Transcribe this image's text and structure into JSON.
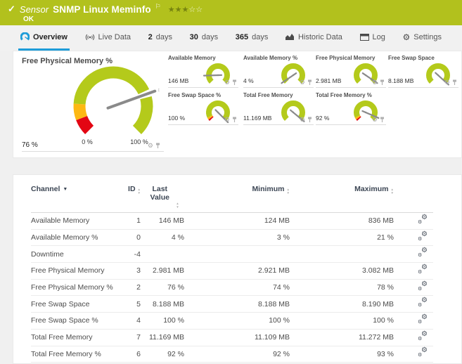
{
  "header": {
    "status_check": "✓",
    "type_label": "Sensor",
    "title": "SNMP Linux Meminfo",
    "flag": "⚐",
    "rating": {
      "filled": 3,
      "empty": 2
    },
    "status": "OK"
  },
  "tabs": {
    "overview": {
      "label": "Overview",
      "icon": "gauge-icon"
    },
    "live_data": {
      "label": "Live Data",
      "icon": "signal-icon"
    },
    "days2": {
      "num": "2",
      "word": "days"
    },
    "days30": {
      "num": "30",
      "word": "days"
    },
    "days365": {
      "num": "365",
      "word": "days"
    },
    "historic": {
      "label": "Historic Data",
      "icon": "chart-icon"
    },
    "log": {
      "label": "Log",
      "icon": "table-icon"
    },
    "settings": {
      "label": "Settings",
      "icon": "gear-icon"
    }
  },
  "colors": {
    "header_green": "#b2c11d",
    "gauge_green": "#b4ca1b",
    "warn_yellow": "#fdb813",
    "error_red": "#e30613",
    "accent_blue": "#1e9cd8",
    "needle_gray": "#8a8a8a"
  },
  "chart_data": {
    "type": "gauge",
    "main": {
      "title": "Free Physical Memory %",
      "value_label": "76 %",
      "percent": 76,
      "min_label": "0 %",
      "max_label": "100 %",
      "segments": [
        {
          "from": 0,
          "to": 9,
          "color": "#e30613"
        },
        {
          "from": 9,
          "to": 18,
          "color": "#fdb813"
        },
        {
          "from": 18,
          "to": 74,
          "color": "#b4ca1b"
        },
        {
          "from": 78,
          "to": 100,
          "color": "#b4ca1b"
        }
      ]
    },
    "small": [
      {
        "title": "Available Memory",
        "value_label": "146 MB",
        "percent": 16,
        "col": 0,
        "row": 0,
        "segments": [
          {
            "from": 0,
            "to": 100,
            "color": "#b4ca1b"
          }
        ]
      },
      {
        "title": "Available Memory %",
        "value_label": "4 %",
        "percent": 4,
        "col": 1,
        "row": 0,
        "segments": [
          {
            "from": 0,
            "to": 100,
            "color": "#b4ca1b"
          }
        ]
      },
      {
        "title": "Free Physical Memory",
        "value_label": "2.981 MB",
        "percent": 96,
        "col": 2,
        "row": 0,
        "segments": [
          {
            "from": 0,
            "to": 100,
            "color": "#b4ca1b"
          }
        ]
      },
      {
        "title": "Free Swap Space",
        "value_label": "8.188 MB",
        "percent": 99,
        "col": 3,
        "row": 0,
        "segments": [
          {
            "from": 0,
            "to": 100,
            "color": "#b4ca1b"
          }
        ]
      },
      {
        "title": "Free Swap Space %",
        "value_label": "100 %",
        "percent": 100,
        "col": 0,
        "row": 1,
        "segments": [
          {
            "from": 0,
            "to": 3,
            "color": "#e30613"
          },
          {
            "from": 3,
            "to": 7,
            "color": "#fdb813"
          },
          {
            "from": 7,
            "to": 100,
            "color": "#b4ca1b"
          }
        ]
      },
      {
        "title": "Total Free Memory",
        "value_label": "11.169 MB",
        "percent": 98,
        "col": 1,
        "row": 1,
        "segments": [
          {
            "from": 0,
            "to": 100,
            "color": "#b4ca1b"
          }
        ]
      },
      {
        "title": "Total Free Memory %",
        "value_label": "92 %",
        "percent": 92,
        "col": 2,
        "row": 1,
        "segments": [
          {
            "from": 0,
            "to": 3,
            "color": "#e30613"
          },
          {
            "from": 3,
            "to": 7,
            "color": "#fdb813"
          },
          {
            "from": 7,
            "to": 100,
            "color": "#b4ca1b"
          }
        ]
      }
    ]
  },
  "table": {
    "headers": {
      "channel": "Channel",
      "id": "ID",
      "last_value": "Last Value",
      "minimum": "Minimum",
      "maximum": "Maximum"
    },
    "rows": [
      {
        "channel": "Available Memory",
        "id": "1",
        "last": "146 MB",
        "min": "124 MB",
        "max": "836 MB"
      },
      {
        "channel": "Available Memory %",
        "id": "0",
        "last": "4 %",
        "min": "3 %",
        "max": "21 %"
      },
      {
        "channel": "Downtime",
        "id": "-4",
        "last": "",
        "min": "",
        "max": ""
      },
      {
        "channel": "Free Physical Memory",
        "id": "3",
        "last": "2.981 MB",
        "min": "2.921 MB",
        "max": "3.082 MB"
      },
      {
        "channel": "Free Physical Memory %",
        "id": "2",
        "last": "76 %",
        "min": "74 %",
        "max": "78 %"
      },
      {
        "channel": "Free Swap Space",
        "id": "5",
        "last": "8.188 MB",
        "min": "8.188 MB",
        "max": "8.190 MB"
      },
      {
        "channel": "Free Swap Space %",
        "id": "4",
        "last": "100 %",
        "min": "100 %",
        "max": "100 %"
      },
      {
        "channel": "Total Free Memory",
        "id": "7",
        "last": "11.169 MB",
        "min": "11.109 MB",
        "max": "11.272 MB"
      },
      {
        "channel": "Total Free Memory %",
        "id": "6",
        "last": "92 %",
        "min": "92 %",
        "max": "93 %"
      }
    ]
  }
}
